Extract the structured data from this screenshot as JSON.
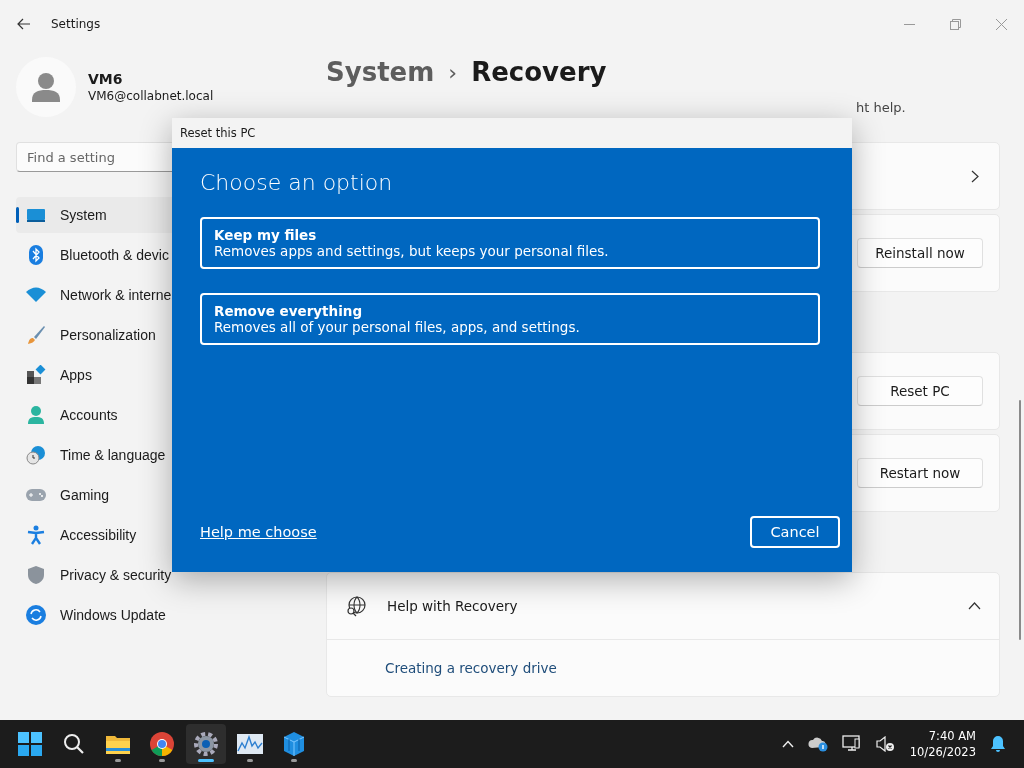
{
  "window": {
    "title": "Settings"
  },
  "user": {
    "name": "VM6",
    "email": "VM6@collabnet.local"
  },
  "search": {
    "placeholder": "Find a setting"
  },
  "sidebar": {
    "items": [
      {
        "label": "System",
        "selected": true
      },
      {
        "label": "Bluetooth & devic",
        "selected": false
      },
      {
        "label": "Network & interne",
        "selected": false
      },
      {
        "label": "Personalization",
        "selected": false
      },
      {
        "label": "Apps",
        "selected": false
      },
      {
        "label": "Accounts",
        "selected": false
      },
      {
        "label": "Time & language",
        "selected": false
      },
      {
        "label": "Gaming",
        "selected": false
      },
      {
        "label": "Accessibility",
        "selected": false
      },
      {
        "label": "Privacy & security",
        "selected": false
      },
      {
        "label": "Windows Update",
        "selected": false
      }
    ]
  },
  "breadcrumb": {
    "parent": "System",
    "separator": "›",
    "current": "Recovery"
  },
  "description_tail": "ht help.",
  "cards": [
    {
      "kind": "chevron"
    },
    {
      "kind": "button",
      "button": "Reinstall now"
    },
    {
      "kind": "gap"
    },
    {
      "kind": "button",
      "button": "Reset PC"
    },
    {
      "kind": "button",
      "button": "Restart now"
    }
  ],
  "related": {
    "title": "Help with Recovery",
    "expanded": true,
    "links": [
      "Creating a recovery drive"
    ]
  },
  "dialog": {
    "title": "Reset this PC",
    "heading": "Choose an option",
    "options": [
      {
        "title": "Keep my files",
        "description": "Removes apps and settings, but keeps your personal files."
      },
      {
        "title": "Remove everything",
        "description": "Removes all of your personal files, apps, and settings."
      }
    ],
    "help_link": "Help me choose",
    "cancel": "Cancel"
  },
  "taskbar": {
    "apps": [
      {
        "running": false,
        "active": false
      },
      {
        "running": false,
        "active": false
      },
      {
        "running": true,
        "active": false
      },
      {
        "running": true,
        "active": false
      },
      {
        "running": true,
        "active": true
      },
      {
        "running": true,
        "active": false
      },
      {
        "running": true,
        "active": false
      }
    ],
    "time": "7:40 AM",
    "date": "10/26/2023"
  }
}
